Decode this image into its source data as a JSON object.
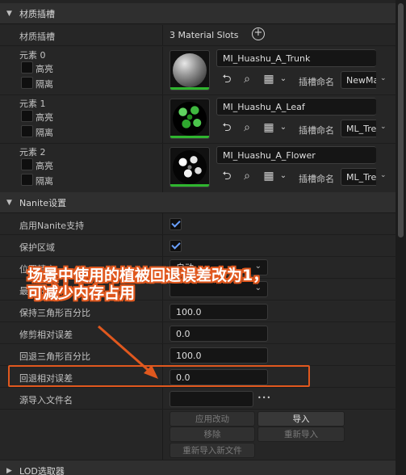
{
  "material_slots_section": {
    "title": "材质插槽",
    "slots_label": "材质插槽",
    "slots_count": "3 Material Slots",
    "elements": [
      {
        "label": "元素 0",
        "highlight": "高亮",
        "isolate": "隔离",
        "material": "MI_Huashu_A_Trunk",
        "slot_name_label": "插槽命名",
        "slot_name": "NewMa"
      },
      {
        "label": "元素 1",
        "highlight": "高亮",
        "isolate": "隔离",
        "material": "MI_Huashu_A_Leaf",
        "slot_name_label": "插槽命名",
        "slot_name": "ML_Tre"
      },
      {
        "label": "元素 2",
        "highlight": "高亮",
        "isolate": "隔离",
        "material": "MI_Huashu_A_Flower",
        "slot_name_label": "插槽命名",
        "slot_name": "ML_Tre"
      }
    ]
  },
  "nanite_section": {
    "title": "Nanite设置",
    "enable_label": "启用Nanite支持",
    "preserve_area_label": "保护区域",
    "position_precision_label": "位置精度",
    "position_precision_value": "自动",
    "min_residency_label": "最小驻留",
    "keep_triangle_percent_label": "保持三角形百分比",
    "keep_triangle_percent_value": "100.0",
    "trim_relative_error_label": "修剪相对误差",
    "trim_relative_error_value": "0.0",
    "fallback_triangle_percent_label": "回退三角形百分比",
    "fallback_triangle_percent_value": "100.0",
    "fallback_relative_error_label": "回退相对误差",
    "fallback_relative_error_value": "0.0",
    "source_import_label": "源导入文件名",
    "source_import_value": "",
    "more_button": "•••",
    "buttons": {
      "apply": "应用改动",
      "import": "导入",
      "remove": "移除",
      "reimport": "重新导入",
      "reimport_new": "重新导入新文件"
    }
  },
  "lod_section": {
    "title": "LOD选取器"
  },
  "annotation": {
    "text": "场景中使用的植被回退误差改为1，可减少内存占用",
    "color": "#e0581e"
  },
  "colors": {
    "accent": "#6aa0ff",
    "thumbnail_bar": "#2fb52f"
  }
}
